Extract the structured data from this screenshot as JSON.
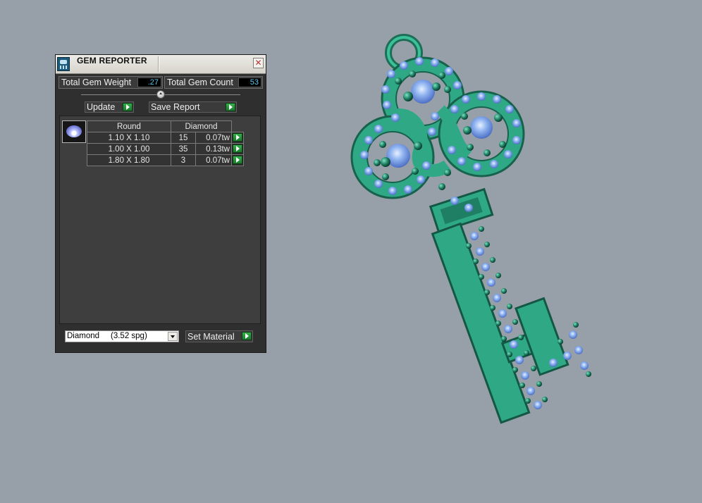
{
  "panel": {
    "title": "GEM REPORTER",
    "close_glyph": "✕",
    "total_weight_label": "Total Gem Weight",
    "total_weight_value": ".27",
    "total_count_label": "Total Gem Count",
    "total_count_value": "53",
    "update_label": "Update",
    "save_report_label": "Save Report",
    "table": {
      "shape": "Round",
      "material": "Diamond",
      "rows": [
        {
          "size": "1.10 X 1.10",
          "count": "15",
          "weight": "0.07tw"
        },
        {
          "size": "1.00 X 1.00",
          "count": "35",
          "weight": "0.13tw"
        },
        {
          "size": "1.80 X 1.80",
          "count": "3",
          "weight": "0.07tw"
        }
      ]
    },
    "material_select": {
      "value": "Diamond     (3.52 spg)"
    },
    "set_material_label": "Set Material"
  },
  "colors": {
    "viewport_bg": "#97a0a8",
    "metal": "#2fa886",
    "gem": "#8fb3f0",
    "accent_value": "#5fc3e8"
  },
  "icons": [
    "gem-reporter-app-icon",
    "close-icon",
    "play-icon",
    "round-gem-icon",
    "dropdown-arrow-icon"
  ]
}
